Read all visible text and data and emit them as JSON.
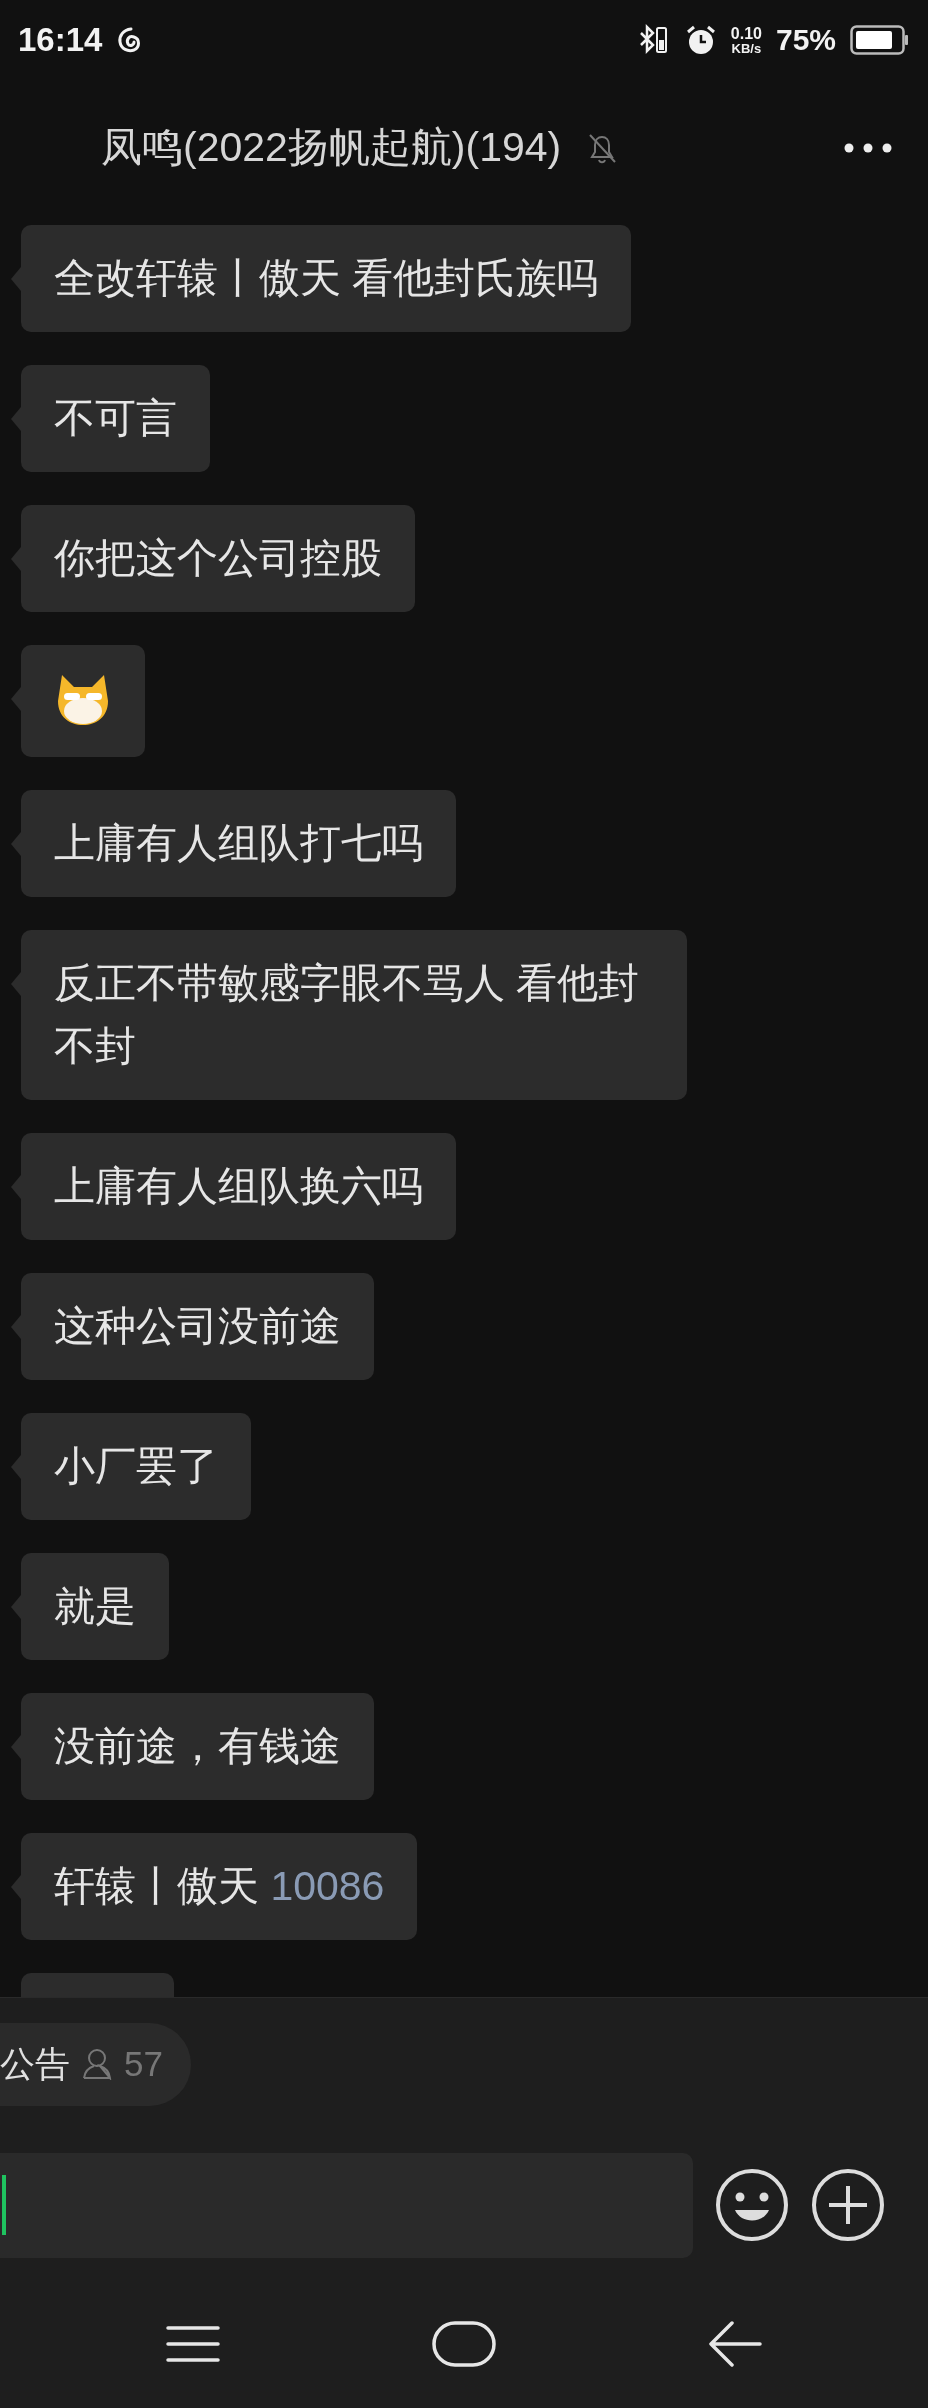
{
  "status_bar": {
    "time": "16:14",
    "speed_value": "0.10",
    "speed_unit": "KB/s",
    "battery": "75%"
  },
  "header": {
    "title": "凤鸣(2022扬帆起航)(194)",
    "muted": true
  },
  "messages": [
    {
      "kind": "text",
      "text": "全改轩辕丨傲天 看他封氏族吗"
    },
    {
      "kind": "text",
      "text": "不可言"
    },
    {
      "kind": "text",
      "text": "你把这个公司控股"
    },
    {
      "kind": "sticker"
    },
    {
      "kind": "text",
      "text": "上庸有人组队打七吗"
    },
    {
      "kind": "text",
      "text": "反正不带敏感字眼不骂人 看他封不封"
    },
    {
      "kind": "text",
      "text": "上庸有人组队换六吗"
    },
    {
      "kind": "text",
      "text": "这种公司没前途"
    },
    {
      "kind": "text",
      "text": "小厂罢了"
    },
    {
      "kind": "text",
      "text": "就是"
    },
    {
      "kind": "text",
      "text": "没前途，有钱途"
    },
    {
      "kind": "mention",
      "text": "轩辕丨傲天",
      "link": "10086"
    },
    {
      "kind": "empty"
    }
  ],
  "announcement": {
    "label": "公告",
    "count": "57"
  }
}
